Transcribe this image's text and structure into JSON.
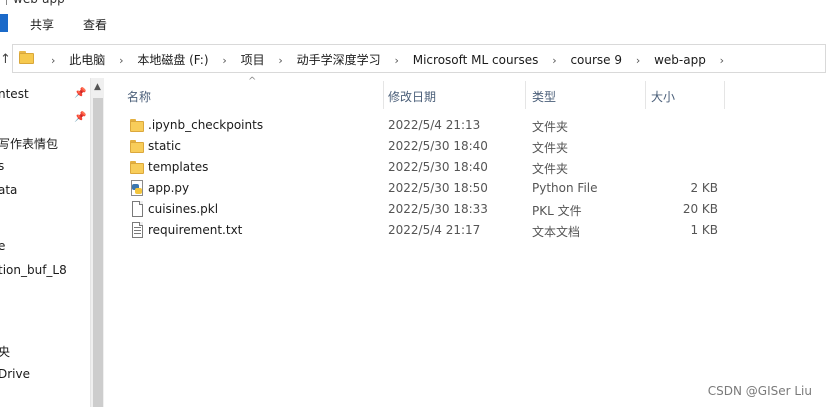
{
  "window": {
    "title_fragment": "web-app"
  },
  "ribbon": {
    "share": "共享",
    "view": "查看"
  },
  "address": {
    "crumbs": [
      "此电脑",
      "本地磁盘 (F:)",
      "项目",
      "动手学深度学习",
      "Microsoft ML courses",
      "course 9",
      "web-app"
    ]
  },
  "nav": {
    "items": [
      "ntest",
      "写作表情包",
      "s",
      "ata",
      "e",
      "tion_buf_L8",
      "央",
      "Drive"
    ]
  },
  "columns": {
    "name": "名称",
    "date": "修改日期",
    "type": "类型",
    "size": "大小"
  },
  "files": [
    {
      "name": ".ipynb_checkpoints",
      "date": "2022/5/4 21:13",
      "type": "文件夹",
      "size": "",
      "icon": "folder-icon"
    },
    {
      "name": "static",
      "date": "2022/5/30 18:40",
      "type": "文件夹",
      "size": "",
      "icon": "folder-icon"
    },
    {
      "name": "templates",
      "date": "2022/5/30 18:40",
      "type": "文件夹",
      "size": "",
      "icon": "folder-icon"
    },
    {
      "name": "app.py",
      "date": "2022/5/30 18:50",
      "type": "Python File",
      "size": "2 KB",
      "icon": "python-file-icon"
    },
    {
      "name": "cuisines.pkl",
      "date": "2022/5/30 18:33",
      "type": "PKL 文件",
      "size": "20 KB",
      "icon": "file-icon"
    },
    {
      "name": "requirement.txt",
      "date": "2022/5/4 21:17",
      "type": "文本文档",
      "size": "1 KB",
      "icon": "text-file-icon"
    }
  ],
  "watermark": "CSDN @GISer Liu",
  "colors": {
    "accent": "#1b6ac9",
    "folder": "#f8cd5a",
    "header_text": "#4c607a"
  }
}
